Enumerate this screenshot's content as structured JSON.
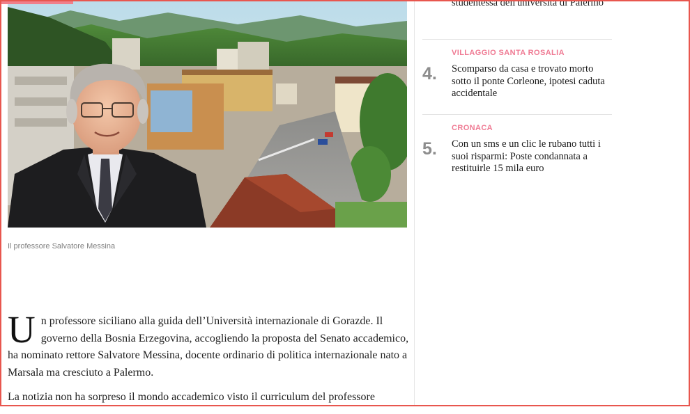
{
  "article": {
    "image_caption": "Il professore Salvatore Messina",
    "dropcap": "U",
    "paragraph1_rest": "n professore siciliano alla guida dell’Università internazionale di Gorazde. Il governo della Bosnia Erzegovina, accogliendo la proposta del Senato accademico, ha nominato rettore Salvatore Messina, docente ordinario di politica internazionale nato a Marsala ma cresciuto a Palermo.",
    "paragraph2": "La notizia non ha sorpreso il mondo accademico visto il curriculum del professore"
  },
  "sidebar": {
    "items": [
      {
        "category": "",
        "number": "",
        "headline": "studentessa dell'università di Palermo"
      },
      {
        "category": "VILLAGGIO SANTA ROSALIA",
        "number": "4.",
        "headline": "Scomparso da casa e trovato morto sotto il ponte Corleone, ipotesi caduta accidentale"
      },
      {
        "category": "CRONACA",
        "number": "5.",
        "headline": "Con un sms e un clic le rubano tutti i suoi risparmi: Poste condannata a restituirle 15 mila euro"
      }
    ]
  },
  "colors": {
    "accent_border": "#e8564e",
    "category_pink": "#ef7a93",
    "number_gray": "#8d8d8d",
    "reading_progress": "#f07f8a"
  },
  "reading_progress_fraction": 0.1
}
